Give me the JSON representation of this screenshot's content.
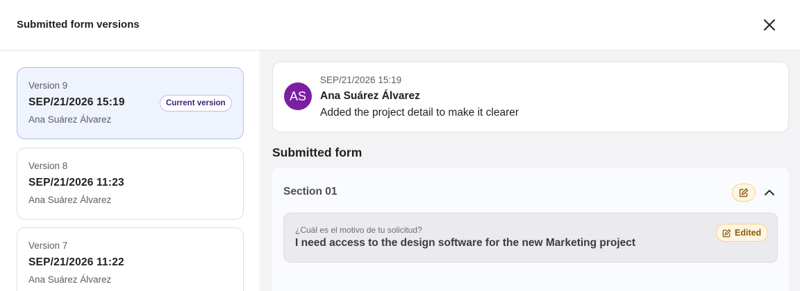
{
  "dialog": {
    "title": "Submitted form versions"
  },
  "versions": [
    {
      "label": "Version 9",
      "date": "SEP/21/2026 15:19",
      "author": "Ana Suárez Álvarez",
      "badge": "Current version",
      "selected": true
    },
    {
      "label": "Version 8",
      "date": "SEP/21/2026 11:23",
      "author": "Ana Suárez Álvarez"
    },
    {
      "label": "Version 7",
      "date": "SEP/21/2026 11:22",
      "author": "Ana Suárez Álvarez"
    }
  ],
  "comment": {
    "avatar_initials": "AS",
    "avatar_color": "#7b1fa2",
    "date": "SEP/21/2026 15:19",
    "author": "Ana Suárez Álvarez",
    "text": "Added the project detail to make it clearer"
  },
  "form": {
    "title": "Submitted form",
    "section": {
      "title": "Section 01",
      "expanded": true,
      "field": {
        "question": "¿Cuál es el motivo de tu solicitud?",
        "answer": "I need access to the design software for the new Marketing project",
        "status": "Edited"
      }
    }
  },
  "icons": {
    "close": "close-icon",
    "edit": "edit-icon",
    "collapse": "chevron-up-icon"
  },
  "colors": {
    "selected_bg": "#eef3fd",
    "selected_border": "#a9c1ea",
    "badge_border": "#c9b7ee",
    "badge_text": "#3a1e7a",
    "edited_bg": "#fff5e0",
    "edited_border": "#f0d39c",
    "edited_text": "#8a5a14"
  }
}
